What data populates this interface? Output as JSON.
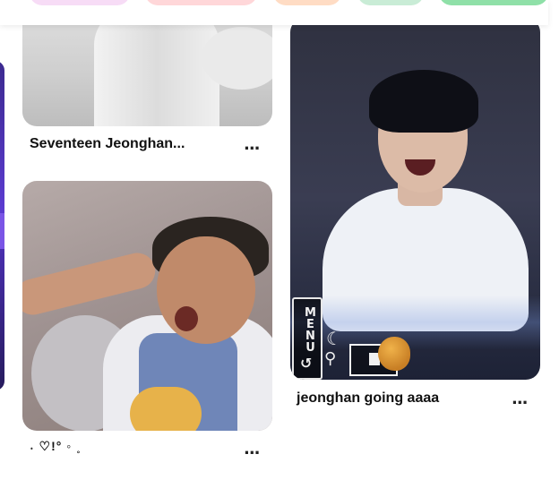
{
  "pins": [
    {
      "title": "Seventeen Jeonghan...",
      "more_label": "..."
    },
    {
      "title": "jeonghan going aaaa",
      "more_label": "..."
    },
    {
      "title": "˖ ♡!° ◦ ˳",
      "more_label": "..."
    }
  ],
  "photo_overlay": {
    "menu_label": "MENU",
    "back_glyph": "↺",
    "moon_glyph": "☾",
    "search_glyph": "⚲"
  },
  "icons": [
    "more-options-icon",
    "potato-sticker-icon",
    "moon-icon",
    "search-icon",
    "back-arrow-icon"
  ]
}
